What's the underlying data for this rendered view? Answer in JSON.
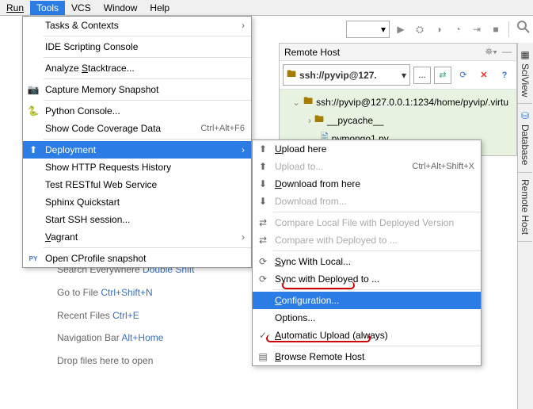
{
  "menubar": {
    "run": "Run",
    "tools": "Tools",
    "vcs": "VCS",
    "window": "Window",
    "help": "Help"
  },
  "menu1": {
    "tasks": "Tasks & Contexts",
    "ide_scripting": "IDE Scripting Console",
    "analyze_stack": "Analyze Stacktrace...",
    "capture_mem": "Capture Memory Snapshot",
    "python_console": "Python Console...",
    "show_code_cov": "Show Code Coverage Data",
    "show_code_cov_short": "Ctrl+Alt+F6",
    "deployment": "Deployment",
    "http_history": "Show HTTP Requests History",
    "rest": "Test RESTful Web Service",
    "sphinx": "Sphinx Quickstart",
    "ssh": "Start SSH session...",
    "vagrant": "Vagrant",
    "cprofile": "Open CProfile snapshot"
  },
  "menu2": {
    "upload_here": "Upload here",
    "upload_to": "Upload to...",
    "upload_to_short": "Ctrl+Alt+Shift+X",
    "download_here": "Download from here",
    "download_from": "Download from...",
    "compare_local": "Compare Local File with Deployed Version",
    "compare_with": "Compare with Deployed to ...",
    "sync_local": "Sync With Local...",
    "sync_deployed": "Sync with Deployed to ...",
    "configuration": "Configuration...",
    "options": "Options...",
    "auto_upload": "Automatic Upload (always)",
    "browse_remote": "Browse Remote Host"
  },
  "remote_host": {
    "title": "Remote Host",
    "host": "ssh://pyvip@127.",
    "tree_root": "ssh://pyvip@127.0.0.1:1234/home/pyvip/.virtu",
    "folder1": "__pycache__",
    "file1": "pymongo1.py"
  },
  "right_tabs": {
    "sciview": "SciView",
    "database": "Database",
    "remote": "Remote Host"
  },
  "tips": {
    "search_label": "Search Everywhere ",
    "search_short": "Double Shift",
    "goto_label": "Go to File ",
    "goto_short": "Ctrl+Shift+N",
    "recent_label": "Recent Files ",
    "recent_short": "Ctrl+E",
    "nav_label": "Navigation Bar ",
    "nav_short": "Alt+Home",
    "drop": "Drop files here to open"
  }
}
